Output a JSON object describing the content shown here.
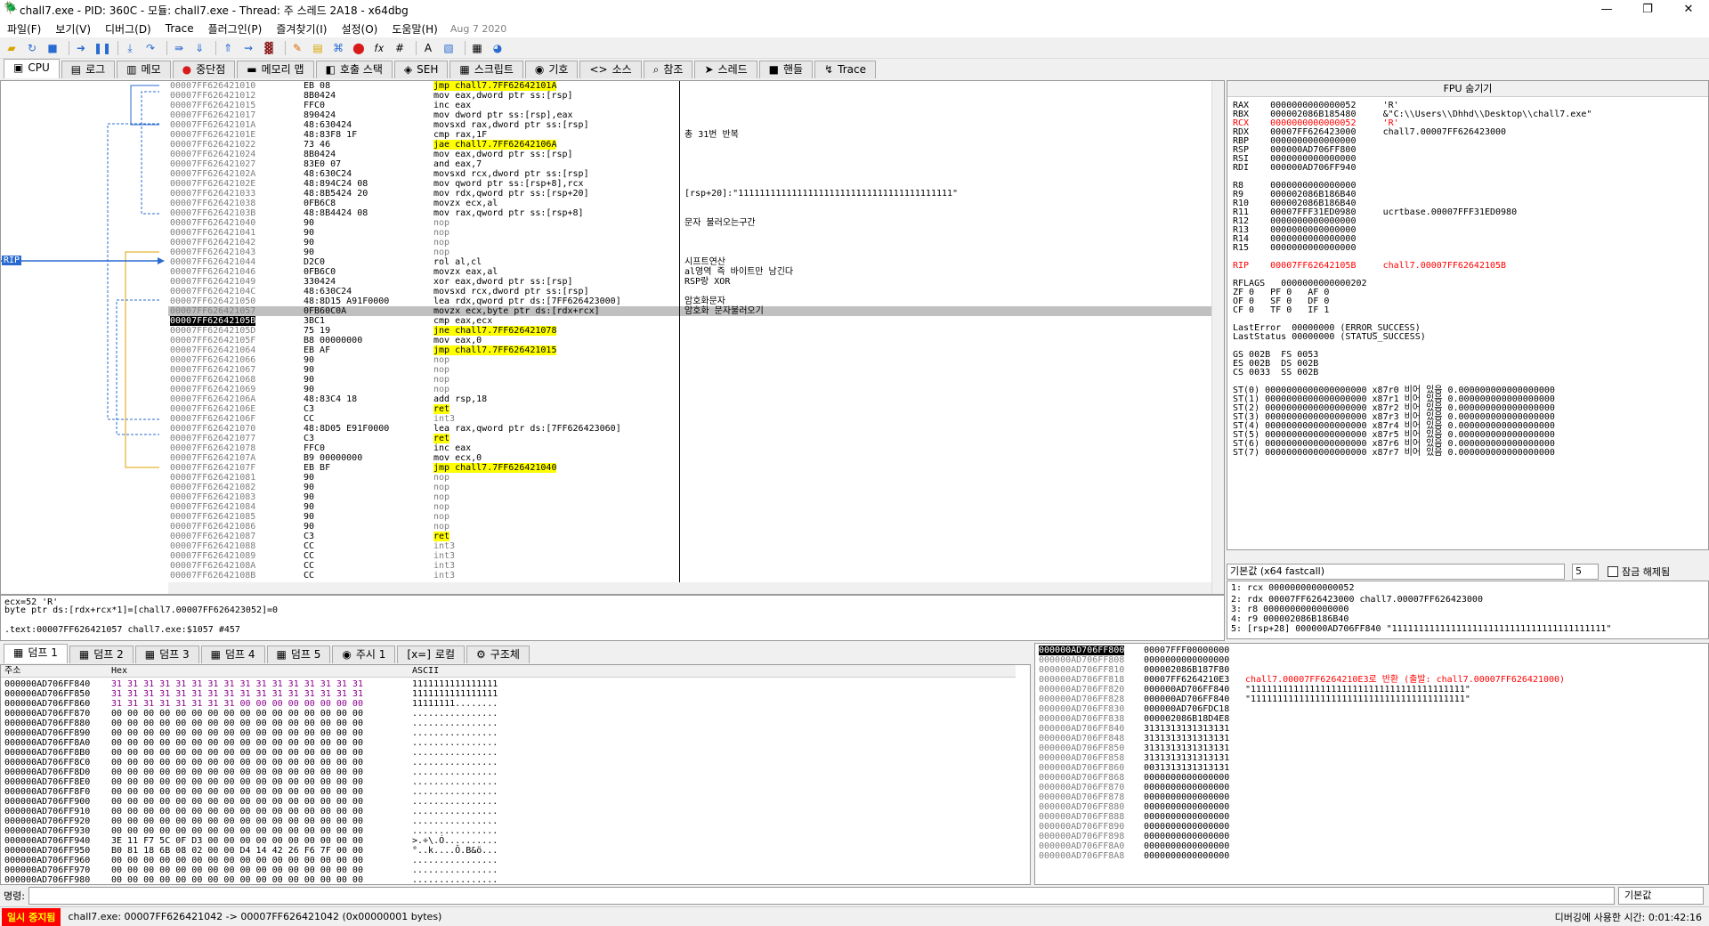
{
  "window": {
    "title": "chall7.exe - PID: 360C - 모듈: chall7.exe - Thread: 주 스레드 2A18 - x64dbg",
    "min": "—",
    "max": "❐",
    "close": "✕"
  },
  "menu": {
    "items": [
      "파일(F)",
      "보기(V)",
      "디버그(D)",
      "Trace",
      "플러그인(P)",
      "즐겨찾기(I)",
      "설정(O)",
      "도움말(H)"
    ],
    "date": "Aug 7 2020"
  },
  "tabs": [
    {
      "icon": "▣",
      "label": "CPU"
    },
    {
      "icon": "▤",
      "label": "로그"
    },
    {
      "icon": "▥",
      "label": "메모"
    },
    {
      "icon": "●",
      "label": "중단점"
    },
    {
      "icon": "▬",
      "label": "메모리 맵"
    },
    {
      "icon": "◧",
      "label": "호출 스택"
    },
    {
      "icon": "◈",
      "label": "SEH"
    },
    {
      "icon": "▦",
      "label": "스크립트"
    },
    {
      "icon": "◉",
      "label": "기호"
    },
    {
      "icon": "<>",
      "label": "소스"
    },
    {
      "icon": "⌕",
      "label": "참조"
    },
    {
      "icon": "➤",
      "label": "스레드"
    },
    {
      "icon": "■",
      "label": "핸들"
    },
    {
      "icon": "↯",
      "label": "Trace"
    }
  ],
  "disasm": {
    "rip_label": "RIP",
    "rows": [
      {
        "addr": "00007FF626421010",
        "bytes": "EB 08",
        "asm": "jmp chall7.7FF62642101A",
        "cmt": "",
        "hl": "jmp"
      },
      {
        "addr": "00007FF626421012",
        "bytes": "8B0424",
        "asm": "mov eax,dword ptr ss:[rsp]",
        "cmt": ""
      },
      {
        "addr": "00007FF626421015",
        "bytes": "FFC0",
        "asm": "inc eax",
        "cmt": ""
      },
      {
        "addr": "00007FF626421017",
        "bytes": "890424",
        "asm": "mov dword ptr ss:[rsp],eax",
        "cmt": ""
      },
      {
        "addr": "00007FF62642101A",
        "bytes": "48:630424",
        "asm": "movsxd rax,dword ptr ss:[rsp]",
        "cmt": ""
      },
      {
        "addr": "00007FF62642101E",
        "bytes": "48:83F8 1F",
        "asm": "cmp rax,1F",
        "cmt": "총 31번 반복"
      },
      {
        "addr": "00007FF626421022",
        "bytes": "73 46",
        "asm": "jae chall7.7FF62642106A",
        "cmt": "",
        "hl": "jmp"
      },
      {
        "addr": "00007FF626421024",
        "bytes": "8B0424",
        "asm": "mov eax,dword ptr ss:[rsp]",
        "cmt": ""
      },
      {
        "addr": "00007FF626421027",
        "bytes": "83E0 07",
        "asm": "and eax,7",
        "cmt": ""
      },
      {
        "addr": "00007FF62642102A",
        "bytes": "48:630C24",
        "asm": "movsxd rcx,dword ptr ss:[rsp]",
        "cmt": ""
      },
      {
        "addr": "00007FF62642102E",
        "bytes": "48:894C24 08",
        "asm": "mov qword ptr ss:[rsp+8],rcx",
        "cmt": ""
      },
      {
        "addr": "00007FF626421033",
        "bytes": "48:8B5424 20",
        "asm": "mov rdx,qword ptr ss:[rsp+20]",
        "cmt": "[rsp+20]:\"1111111111111111111111111111111111111111\""
      },
      {
        "addr": "00007FF626421038",
        "bytes": "0FB6C8",
        "asm": "movzx ecx,al",
        "cmt": ""
      },
      {
        "addr": "00007FF62642103B",
        "bytes": "48:8B4424 08",
        "asm": "mov rax,qword ptr ss:[rsp+8]",
        "cmt": ""
      },
      {
        "addr": "00007FF626421040",
        "bytes": "90",
        "asm": "nop",
        "cmt": "문자 불러오는구간"
      },
      {
        "addr": "00007FF626421041",
        "bytes": "90",
        "asm": "nop",
        "cmt": ""
      },
      {
        "addr": "00007FF626421042",
        "bytes": "90",
        "asm": "nop",
        "cmt": ""
      },
      {
        "addr": "00007FF626421043",
        "bytes": "90",
        "asm": "nop",
        "cmt": ""
      },
      {
        "addr": "00007FF626421044",
        "bytes": "D2C0",
        "asm": "rol al,cl",
        "cmt": "시프트연산"
      },
      {
        "addr": "00007FF626421046",
        "bytes": "0FB6C0",
        "asm": "movzx eax,al",
        "cmt": "al영역 즉 바이트만 남긴다"
      },
      {
        "addr": "00007FF626421049",
        "bytes": "330424",
        "asm": "xor eax,dword ptr ss:[rsp]",
        "cmt": "RSP랑 XOR"
      },
      {
        "addr": "00007FF62642104C",
        "bytes": "48:630C24",
        "asm": "movsxd rcx,dword ptr ss:[rsp]",
        "cmt": ""
      },
      {
        "addr": "00007FF626421050",
        "bytes": "48:8D15 A91F0000",
        "asm": "lea rdx,qword ptr ds:[7FF626423000]",
        "cmt": "암호화문자"
      },
      {
        "addr": "00007FF626421057",
        "bytes": "0FB60C0A",
        "asm": "movzx ecx,byte ptr ds:[rdx+rcx]",
        "cmt": "암호화 문자불러오기",
        "sel": true
      },
      {
        "addr": "00007FF62642105B",
        "bytes": "3BC1",
        "asm": "cmp eax,ecx",
        "cmt": "",
        "rip": true
      },
      {
        "addr": "00007FF62642105D",
        "bytes": "75 19",
        "asm": "jne chall7.7FF626421078",
        "cmt": "",
        "hl": "jmp"
      },
      {
        "addr": "00007FF62642105F",
        "bytes": "B8 00000000",
        "asm": "mov eax,0",
        "cmt": ""
      },
      {
        "addr": "00007FF626421064",
        "bytes": "EB AF",
        "asm": "jmp chall7.7FF626421015",
        "cmt": "",
        "hl": "jmp"
      },
      {
        "addr": "00007FF626421066",
        "bytes": "90",
        "asm": "nop",
        "cmt": ""
      },
      {
        "addr": "00007FF626421067",
        "bytes": "90",
        "asm": "nop",
        "cmt": ""
      },
      {
        "addr": "00007FF626421068",
        "bytes": "90",
        "asm": "nop",
        "cmt": ""
      },
      {
        "addr": "00007FF626421069",
        "bytes": "90",
        "asm": "nop",
        "cmt": ""
      },
      {
        "addr": "00007FF62642106A",
        "bytes": "48:83C4 18",
        "asm": "add rsp,18",
        "cmt": ""
      },
      {
        "addr": "00007FF62642106E",
        "bytes": "C3",
        "asm": "ret",
        "cmt": "",
        "hl": "ret"
      },
      {
        "addr": "00007FF62642106F",
        "bytes": "CC",
        "asm": "int3",
        "cmt": ""
      },
      {
        "addr": "00007FF626421070",
        "bytes": "48:8D05 E91F0000",
        "asm": "lea rax,qword ptr ds:[7FF626423060]",
        "cmt": ""
      },
      {
        "addr": "00007FF626421077",
        "bytes": "C3",
        "asm": "ret",
        "cmt": "",
        "hl": "ret"
      },
      {
        "addr": "00007FF626421078",
        "bytes": "FFC0",
        "asm": "inc eax",
        "cmt": ""
      },
      {
        "addr": "00007FF62642107A",
        "bytes": "B9 00000000",
        "asm": "mov ecx,0",
        "cmt": ""
      },
      {
        "addr": "00007FF62642107F",
        "bytes": "EB BF",
        "asm": "jmp chall7.7FF626421040",
        "cmt": "",
        "hl": "jmp"
      },
      {
        "addr": "00007FF626421081",
        "bytes": "90",
        "asm": "nop",
        "cmt": ""
      },
      {
        "addr": "00007FF626421082",
        "bytes": "90",
        "asm": "nop",
        "cmt": ""
      },
      {
        "addr": "00007FF626421083",
        "bytes": "90",
        "asm": "nop",
        "cmt": ""
      },
      {
        "addr": "00007FF626421084",
        "bytes": "90",
        "asm": "nop",
        "cmt": ""
      },
      {
        "addr": "00007FF626421085",
        "bytes": "90",
        "asm": "nop",
        "cmt": ""
      },
      {
        "addr": "00007FF626421086",
        "bytes": "90",
        "asm": "nop",
        "cmt": ""
      },
      {
        "addr": "00007FF626421087",
        "bytes": "C3",
        "asm": "ret",
        "cmt": "",
        "hl": "ret"
      },
      {
        "addr": "00007FF626421088",
        "bytes": "CC",
        "asm": "int3",
        "cmt": ""
      },
      {
        "addr": "00007FF626421089",
        "bytes": "CC",
        "asm": "int3",
        "cmt": ""
      },
      {
        "addr": "00007FF62642108A",
        "bytes": "CC",
        "asm": "int3",
        "cmt": ""
      },
      {
        "addr": "00007FF62642108B",
        "bytes": "CC",
        "asm": "int3",
        "cmt": ""
      }
    ]
  },
  "registers": {
    "header": "FPU 숨기기",
    "rows": [
      {
        "t": "RAX    0000000000000052     'R'"
      },
      {
        "t": "RBX    000002086B185480     &\"C:\\\\Users\\\\Dhhd\\\\Desktop\\\\chall7.exe\""
      },
      {
        "t": "RCX    0000000000000052     'R'",
        "red": true
      },
      {
        "t": "RDX    00007FF626423000     chall7.00007FF626423000"
      },
      {
        "t": "RBP    0000000000000000"
      },
      {
        "t": "RSP    000000AD706FF800"
      },
      {
        "t": "RSI    0000000000000000"
      },
      {
        "t": "RDI    000000AD706FF940"
      },
      {
        "t": ""
      },
      {
        "t": "R8     0000000000000000"
      },
      {
        "t": "R9     000002086B186B40"
      },
      {
        "t": "R10    000002086B186B40"
      },
      {
        "t": "R11    00007FFF31ED0980     ucrtbase.00007FFF31ED0980"
      },
      {
        "t": "R12    0000000000000000"
      },
      {
        "t": "R13    0000000000000000"
      },
      {
        "t": "R14    0000000000000000"
      },
      {
        "t": "R15    0000000000000000"
      },
      {
        "t": ""
      },
      {
        "t": "RIP    00007FF62642105B     chall7.00007FF62642105B",
        "red": true
      },
      {
        "t": ""
      },
      {
        "t": "RFLAGS   0000000000000202"
      },
      {
        "t": "ZF 0   PF 0   AF 0"
      },
      {
        "t": "OF 0   SF 0   DF 0"
      },
      {
        "t": "CF 0   TF 0   IF 1"
      },
      {
        "t": ""
      },
      {
        "t": "LastError  00000000 (ERROR_SUCCESS)"
      },
      {
        "t": "LastStatus 00000000 (STATUS_SUCCESS)"
      },
      {
        "t": ""
      },
      {
        "t": "GS 002B  FS 0053"
      },
      {
        "t": "ES 002B  DS 002B"
      },
      {
        "t": "CS 0033  SS 002B"
      },
      {
        "t": ""
      },
      {
        "t": "ST(0) 0000000000000000000 x87r0 비어 있음 0.000000000000000000"
      },
      {
        "t": "ST(1) 0000000000000000000 x87r1 비어 있음 0.000000000000000000"
      },
      {
        "t": "ST(2) 0000000000000000000 x87r2 비어 있음 0.000000000000000000"
      },
      {
        "t": "ST(3) 0000000000000000000 x87r3 비어 있음 0.000000000000000000"
      },
      {
        "t": "ST(4) 0000000000000000000 x87r4 비어 있음 0.000000000000000000"
      },
      {
        "t": "ST(5) 0000000000000000000 x87r5 비어 있음 0.000000000000000000"
      },
      {
        "t": "ST(6) 0000000000000000000 x87r6 비어 있음 0.000000000000000000"
      },
      {
        "t": "ST(7) 0000000000000000000 x87r7 비어 있음 0.000000000000000000"
      }
    ]
  },
  "callconv": {
    "label": "기본값 (x64 fastcall)",
    "count": "5",
    "unlock": "잠금 해제됨"
  },
  "args": [
    "1: rcx 0000000000000052",
    "2: rdx 00007FF626423000 chall7.00007FF626423000",
    "3: r8 0000000000000000",
    "4: r9 000002086B186B40",
    "5: [rsp+28] 000000AD706FF840 \"1111111111111111111111111111111111111111\""
  ],
  "info": [
    "ecx=52 'R'",
    "byte ptr ds:[rdx+rcx*1]=[chall7.00007FF626423052]=0",
    "",
    ".text:00007FF626421057 chall7.exe:$1057 #457"
  ],
  "dumptabs": [
    {
      "icon": "▦",
      "label": "덤프 1"
    },
    {
      "icon": "▦",
      "label": "덤프 2"
    },
    {
      "icon": "▦",
      "label": "덤프 3"
    },
    {
      "icon": "▦",
      "label": "덤프 4"
    },
    {
      "icon": "▦",
      "label": "덤프 5"
    },
    {
      "icon": "◉",
      "label": "주시 1"
    },
    {
      "icon": "[x=]",
      "label": "로컬"
    },
    {
      "icon": "⚙",
      "label": "구조체"
    }
  ],
  "dump": {
    "headers": {
      "addr": "주소",
      "hex": "Hex",
      "ascii": "ASCII"
    },
    "rows": [
      {
        "a": "000000AD706FF840",
        "h": "31 31 31 31 31 31 31 31 31 31 31 31 31 31 31 31",
        "s": "1111111111111111"
      },
      {
        "a": "000000AD706FF850",
        "h": "31 31 31 31 31 31 31 31 31 31 31 31 31 31 31 31",
        "s": "1111111111111111"
      },
      {
        "a": "000000AD706FF860",
        "h": "31 31 31 31 31 31 31 31 00 00 00 00 00 00 00 00",
        "s": "11111111........"
      },
      {
        "a": "000000AD706FF870",
        "h": "00 00 00 00 00 00 00 00 00 00 00 00 00 00 00 00",
        "s": "................"
      },
      {
        "a": "000000AD706FF880",
        "h": "00 00 00 00 00 00 00 00 00 00 00 00 00 00 00 00",
        "s": "................"
      },
      {
        "a": "000000AD706FF890",
        "h": "00 00 00 00 00 00 00 00 00 00 00 00 00 00 00 00",
        "s": "................"
      },
      {
        "a": "000000AD706FF8A0",
        "h": "00 00 00 00 00 00 00 00 00 00 00 00 00 00 00 00",
        "s": "................"
      },
      {
        "a": "000000AD706FF8B0",
        "h": "00 00 00 00 00 00 00 00 00 00 00 00 00 00 00 00",
        "s": "................"
      },
      {
        "a": "000000AD706FF8C0",
        "h": "00 00 00 00 00 00 00 00 00 00 00 00 00 00 00 00",
        "s": "................"
      },
      {
        "a": "000000AD706FF8D0",
        "h": "00 00 00 00 00 00 00 00 00 00 00 00 00 00 00 00",
        "s": "................"
      },
      {
        "a": "000000AD706FF8E0",
        "h": "00 00 00 00 00 00 00 00 00 00 00 00 00 00 00 00",
        "s": "................"
      },
      {
        "a": "000000AD706FF8F0",
        "h": "00 00 00 00 00 00 00 00 00 00 00 00 00 00 00 00",
        "s": "................"
      },
      {
        "a": "000000AD706FF900",
        "h": "00 00 00 00 00 00 00 00 00 00 00 00 00 00 00 00",
        "s": "................"
      },
      {
        "a": "000000AD706FF910",
        "h": "00 00 00 00 00 00 00 00 00 00 00 00 00 00 00 00",
        "s": "................"
      },
      {
        "a": "000000AD706FF920",
        "h": "00 00 00 00 00 00 00 00 00 00 00 00 00 00 00 00",
        "s": "................"
      },
      {
        "a": "000000AD706FF930",
        "h": "00 00 00 00 00 00 00 00 00 00 00 00 00 00 00 00",
        "s": "................"
      },
      {
        "a": "000000AD706FF940",
        "h": "3E 11 F7 5C 0F D3 00 00 00 00 00 00 00 00 00 00",
        "s": ">.÷\\.Ó.........."
      },
      {
        "a": "000000AD706FF950",
        "h": "B0 81 18 6B 08 02 00 00 D4 14 42 26 F6 7F 00 00",
        "s": "°..k....Ô.B&ö..."
      },
      {
        "a": "000000AD706FF960",
        "h": "00 00 00 00 00 00 00 00 00 00 00 00 00 00 00 00",
        "s": "................"
      },
      {
        "a": "000000AD706FF970",
        "h": "00 00 00 00 00 00 00 00 00 00 00 00 00 00 00 00",
        "s": "................"
      },
      {
        "a": "000000AD706FF980",
        "h": "00 00 00 00 00 00 00 00 00 00 00 00 00 00 00 00",
        "s": "................"
      }
    ]
  },
  "stack": {
    "rows": [
      {
        "a": "000000AD706FF800",
        "v": "00007FFF00000000",
        "c": "",
        "top": true
      },
      {
        "a": "000000AD706FF808",
        "v": "0000000000000000",
        "c": ""
      },
      {
        "a": "000000AD706FF810",
        "v": "000002086B187F80",
        "c": ""
      },
      {
        "a": "000000AD706FF818",
        "v": "00007FF6264210E3",
        "c": "chall7.00007FF6264210E3로 반환 (출발: chall7.00007FF626421000)",
        "red": true
      },
      {
        "a": "000000AD706FF820",
        "v": "000000AD706FF840",
        "c": "\"1111111111111111111111111111111111111111\""
      },
      {
        "a": "000000AD706FF828",
        "v": "000000AD706FF840",
        "c": "\"1111111111111111111111111111111111111111\""
      },
      {
        "a": "000000AD706FF830",
        "v": "000000AD706FDC18",
        "c": ""
      },
      {
        "a": "000000AD706FF838",
        "v": "000002086B18D4E8",
        "c": ""
      },
      {
        "a": "000000AD706FF840",
        "v": "3131313131313131",
        "c": ""
      },
      {
        "a": "000000AD706FF848",
        "v": "3131313131313131",
        "c": ""
      },
      {
        "a": "000000AD706FF850",
        "v": "3131313131313131",
        "c": ""
      },
      {
        "a": "000000AD706FF858",
        "v": "3131313131313131",
        "c": ""
      },
      {
        "a": "000000AD706FF860",
        "v": "0031313131313131",
        "c": ""
      },
      {
        "a": "000000AD706FF868",
        "v": "0000000000000000",
        "c": ""
      },
      {
        "a": "000000AD706FF870",
        "v": "0000000000000000",
        "c": ""
      },
      {
        "a": "000000AD706FF878",
        "v": "0000000000000000",
        "c": ""
      },
      {
        "a": "000000AD706FF880",
        "v": "0000000000000000",
        "c": ""
      },
      {
        "a": "000000AD706FF888",
        "v": "0000000000000000",
        "c": ""
      },
      {
        "a": "000000AD706FF890",
        "v": "0000000000000000",
        "c": ""
      },
      {
        "a": "000000AD706FF898",
        "v": "0000000000000000",
        "c": ""
      },
      {
        "a": "000000AD706FF8A0",
        "v": "0000000000000000",
        "c": ""
      },
      {
        "a": "000000AD706FF8A8",
        "v": "0000000000000000",
        "c": ""
      }
    ]
  },
  "cmd": {
    "label": "명령:",
    "default": "기본값"
  },
  "status": {
    "paused": "일시 중지됨",
    "msg": "chall7.exe: 00007FF626421042 -> 00007FF626421042 (0x00000001 bytes)",
    "right": "디버깅에 사용한 시간: 0:01:42:16"
  }
}
